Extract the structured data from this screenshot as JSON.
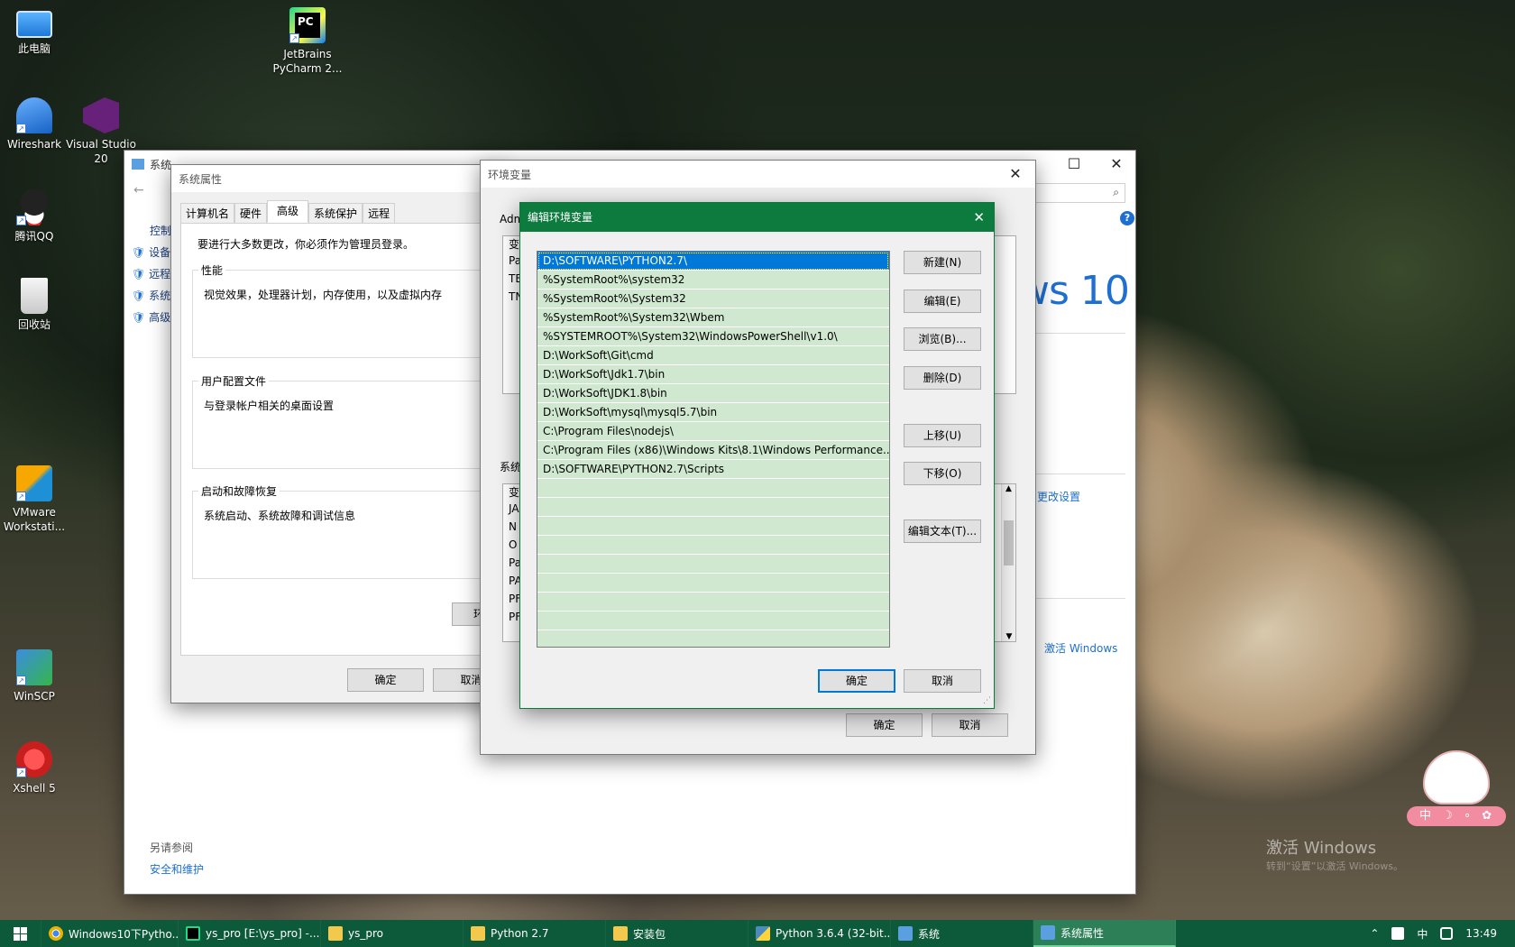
{
  "desktop": {
    "icons": [
      {
        "label": "此电脑",
        "icon": "computer-icon"
      },
      {
        "label": "JetBrains PyCharm 2...",
        "icon": "pycharm-icon"
      },
      {
        "label": "Wireshark",
        "icon": "wireshark-icon"
      },
      {
        "label": "Visual Studio 20",
        "icon": "visual-studio-icon"
      },
      {
        "label": "腾讯QQ",
        "icon": "qq-icon"
      },
      {
        "label": "回收站",
        "icon": "recycle-bin-icon"
      },
      {
        "label": "VMware Workstati...",
        "icon": "vmware-icon"
      },
      {
        "label": "WinSCP",
        "icon": "winscp-icon"
      },
      {
        "label": "Xshell 5",
        "icon": "xshell-icon"
      }
    ],
    "watermark_line1": "激活 Windows",
    "watermark_line2": "转到“设置”以激活 Windows。"
  },
  "system_window": {
    "title": "系统",
    "control_label": "控制",
    "links": [
      "设备",
      "远程",
      "系统",
      "高级"
    ],
    "win10_text": "ws 10",
    "change_settings": "更改设置",
    "activate": "激活 Windows",
    "see_also": "另请参阅",
    "security": "安全和维护"
  },
  "sys_props": {
    "title": "系统属性",
    "tabs": [
      "计算机名",
      "硬件",
      "高级",
      "系统保护",
      "远程"
    ],
    "active_tab": "高级",
    "admin_note": "要进行大多数更改，你必须作为管理员登录。",
    "perf_title": "性能",
    "perf_desc": "视觉效果，处理器计划，内存使用，以及虚拟内存",
    "profile_title": "用户配置文件",
    "profile_desc": "与登录帐户相关的桌面设置",
    "startup_title": "启动和故障恢复",
    "startup_desc": "系统启动、系统故障和调试信息",
    "env_btn_partial": "环",
    "ok": "确定",
    "cancel": "取消"
  },
  "env_vars": {
    "title": "环境变量",
    "user_label": "Adm",
    "sys_label": "系统",
    "user_rows": [
      "变",
      "Pa",
      "TE",
      "TN"
    ],
    "sys_rows": [
      "变",
      "JA",
      "N",
      "O",
      "Pa",
      "PA",
      "PF",
      "PF"
    ],
    "ok": "确定",
    "cancel": "取消"
  },
  "edit_env": {
    "title": "编辑环境变量",
    "paths": [
      "D:\\SOFTWARE\\PYTHON2.7\\",
      "%SystemRoot%\\system32",
      "%SystemRoot%\\System32",
      "%SystemRoot%\\System32\\Wbem",
      "%SYSTEMROOT%\\System32\\WindowsPowerShell\\v1.0\\",
      "D:\\WorkSoft\\Git\\cmd",
      "D:\\WorkSoft\\Jdk1.7\\bin",
      "D:\\WorkSoft\\JDK1.8\\bin",
      "D:\\WorkSoft\\mysql\\mysql5.7\\bin",
      "C:\\Program Files\\nodejs\\",
      "C:\\Program Files (x86)\\Windows Kits\\8.1\\Windows Performance...",
      "D:\\SOFTWARE\\PYTHON2.7\\Scripts",
      "",
      "",
      "",
      "",
      "",
      "",
      "",
      "",
      ""
    ],
    "buttons": {
      "new": "新建(N)",
      "edit": "编辑(E)",
      "browse": "浏览(B)...",
      "delete": "删除(D)",
      "up": "上移(U)",
      "down": "下移(O)",
      "edit_text": "编辑文本(T)...",
      "ok": "确定",
      "cancel": "取消"
    }
  },
  "taskbar": {
    "items": [
      {
        "label": "Windows10下Pytho...",
        "icon": "chrome-icon",
        "color": "#e8b400"
      },
      {
        "label": "ys_pro [E:\\ys_pro] -...",
        "icon": "pycharm-icon",
        "color": "#21d789"
      },
      {
        "label": "ys_pro",
        "icon": "folder-icon",
        "color": "#f2c94c"
      },
      {
        "label": "Python 2.7",
        "icon": "folder-icon",
        "color": "#f2c94c"
      },
      {
        "label": "安装包",
        "icon": "folder-icon",
        "color": "#f2c94c"
      },
      {
        "label": "Python 3.6.4 (32-bit...",
        "icon": "python-icon",
        "color": "#4b8bbe"
      },
      {
        "label": "系统",
        "icon": "system-icon",
        "color": "#5aa0e0"
      },
      {
        "label": "系统属性",
        "icon": "system-props-icon",
        "color": "#5aa0e0"
      }
    ],
    "ime": "中",
    "time": "13:49"
  },
  "sticker": {
    "ime_label": "中"
  }
}
